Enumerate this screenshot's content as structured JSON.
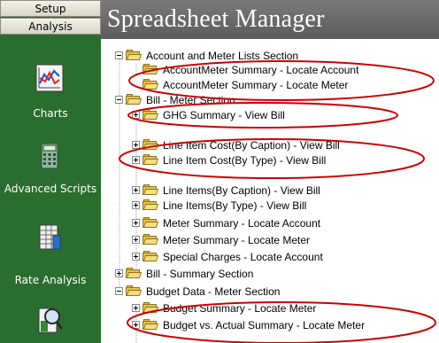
{
  "nav": {
    "setup_label": "Setup",
    "analysis_label": "Analysis",
    "items": [
      {
        "label": "Charts",
        "icon": "chart-icon"
      },
      {
        "label": "Advanced Scripts",
        "icon": "calculator-icon"
      },
      {
        "label": "Rate Analysis",
        "icon": "spreadsheet-icon"
      },
      {
        "label": "",
        "icon": "magnifier-report-icon"
      }
    ]
  },
  "header": {
    "title": "Spreadsheet Manager"
  },
  "tree": {
    "rows": [
      {
        "label": "Account and Meter Lists Section",
        "state": "expanded"
      },
      {
        "label": "AccountMeter Summary - Locate Account",
        "state": "leaf"
      },
      {
        "label": "AccountMeter Summary - Locate Meter",
        "state": "leaf"
      },
      {
        "label": "Bill - Meter Section",
        "state": "expanded"
      },
      {
        "label": "GHG Summary - View Bill",
        "state": "collapsed"
      },
      {
        "label": "Line Item Cost(By Caption) - View Bill",
        "state": "collapsed"
      },
      {
        "label": "Line Item Cost(By Type) - View Bill",
        "state": "collapsed"
      },
      {
        "label": "Line Items(By Caption) - View Bill",
        "state": "collapsed"
      },
      {
        "label": "Line Items(By Type) - View Bill",
        "state": "collapsed"
      },
      {
        "label": "Meter Summary - Locate Account",
        "state": "collapsed"
      },
      {
        "label": "Meter Summary - Locate Meter",
        "state": "collapsed"
      },
      {
        "label": "Special Charges - Locate Account",
        "state": "collapsed"
      },
      {
        "label": "Bill - Summary Section",
        "state": "collapsed"
      },
      {
        "label": "Budget Data - Meter Section",
        "state": "expanded"
      },
      {
        "label": "Budget Summary - Locate Meter",
        "state": "collapsed"
      },
      {
        "label": "Budget vs. Actual Summary - Locate Meter",
        "state": "collapsed"
      }
    ]
  },
  "colors": {
    "sidebar": "#2a6e2f",
    "header": "#6b6b6b",
    "highlight_circle": "#cc0000"
  }
}
